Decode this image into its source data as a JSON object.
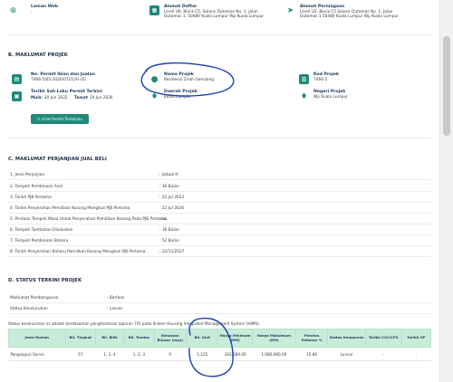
{
  "top": {
    "laman_web": {
      "label": "Laman Web",
      "value": "-"
    },
    "alamat_daftar": {
      "label": "Alamat Daftar",
      "line1": "Level U6, Block C5, Solaris Dutamas No. 1, Jalan",
      "line2": "Dutamas 1, 50480 Kuala Lumpur Wp Kuala Lumpur"
    },
    "alamat_perniagaan": {
      "label": "Alamat Perniagaan",
      "line1": "Level U2, Block C5 Solaris Dutamas No. 1, Jalan",
      "line2": "Dutamas 1 50480 Kuala Lumpur Wp Kuala Lumpur"
    }
  },
  "projek": {
    "title": "B. MAKLUMAT PROJEK",
    "no_permit_label": "No. Permit Iklan dan Jualan",
    "no_permit_value": "7466-5/05-2026/0721(A)-(S)",
    "nama_projek_label": "Nama Projek",
    "nama_projek_value": "Residensi Zirah Gemilang",
    "kod_projek_label": "Kod Projek",
    "kod_projek_value": "7466-5",
    "tarikh_label": "Tarikh Sah Laku Permit Terkini",
    "mula_label": "Mula",
    "mula_value": ": 20 Jun 2022",
    "tamat_label": "Tamat",
    "tamat_value": ": 19 Jun 2026",
    "daerah_label": "Daerah Projek",
    "daerah_value": "Kuala Lumpur",
    "negeri_label": "Negeri Projek",
    "negeri_value": "Wp Kuala Lumpur",
    "button_label": "Lihat Permit Terdahulu"
  },
  "perjanjian": {
    "title": "C. MAKLUMAT PERJANJIAN JUAL BELI",
    "rows": [
      {
        "label": "1. Jenis Perjanjian",
        "value": ": Jadual H"
      },
      {
        "label": "2. Tempoh Pembinaan Asal",
        "value": ": 36 Bulan"
      },
      {
        "label": "3. Tarikh PJB Pertama",
        "value": ": 22 Jul 2023"
      },
      {
        "label": "4. Tarikh Penyerahan Pemilikan Kosong Mengikut PJB Pertama",
        "value": ": 22 Jul 2026"
      },
      {
        "label": "5. Pindaan Tempoh Masa Untuk Penyerahan Pemilikan Kosong Pada PJB Pertama",
        "value": ": na"
      },
      {
        "label": "6. Tempoh Tambahan Diluluskan",
        "value": ": 16 Bulan"
      },
      {
        "label": "7. Tempoh Pembinaan Baharu",
        "value": ": 52 Bulan"
      },
      {
        "label": "8. Tarikh Penyerahan Baharu Pemilikan Kosong Mengikut PJB Pertama",
        "value": ": 22/11/2027"
      }
    ]
  },
  "status": {
    "title": "D. STATUS TERKINI PROJEK",
    "pembangunan_label": "Maklumat Pembangunan",
    "pembangunan_value": ": Berfasa",
    "keseluruhan_label": "Status Keseluruhan",
    "keseluruhan_value": ": Lancar",
    "note": "Status keseluruhan ini adalah berdasarkan penghantaran laporan 7(f) pada Sistem Housing Integrated Management System (HIMS).",
    "headers": [
      "Jenis Rumah",
      "Bil. Tingkat",
      "Bil. Bilik",
      "Bil. Tandas",
      "Keluasan Binaan (mps)",
      "Bil. Unit",
      "Harga Minimum (RM)",
      "Harga Maksimum (RM)",
      "Peratus Sebenar %",
      "Status Komponen",
      "Tarikh CCC/CFO",
      "Tarikh VP"
    ],
    "rows": [
      [
        "Pangsapuri Servis",
        "57",
        "1, 2, 4",
        "1, 2, 3",
        "0",
        "1,125",
        "302,580.00",
        "1,080,960.00",
        "15.86",
        "Lancar",
        "-",
        "-"
      ]
    ]
  },
  "colors": {
    "accent": "#1f8a78",
    "header_bg": "#c8ecd9",
    "annotation": "#1a3fb4"
  }
}
